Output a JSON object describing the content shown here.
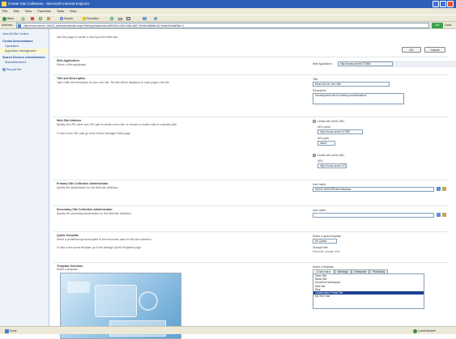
{
  "window": {
    "title": "Create Site Collection - Microsoft Internet Explorer"
  },
  "menu": [
    "File",
    "Edit",
    "View",
    "Favorites",
    "Tools",
    "Help"
  ],
  "toolbar": {
    "back": "Back",
    "search": "Search",
    "favorites": "Favorites",
    "go": "Go",
    "links": "Links"
  },
  "address": {
    "label": "Address",
    "url": "http://moss-server:16543/_admin/createsite.aspx?WebApplicationId=a39f00df-c1b9-4d8c-a5f7-49e5b2d8b6e1&CreateDefaultSite=1"
  },
  "sidebar": {
    "items": [
      {
        "label": "View All Site Content"
      },
      {
        "label": "Central Administration"
      },
      {
        "label": "Operations"
      },
      {
        "label": "Application Management"
      },
      {
        "label": "Shared Services Administration"
      },
      {
        "label": "SharedServices1"
      },
      {
        "label": "Recycle Bin"
      }
    ]
  },
  "page": {
    "intro": "Use this page to create a new top-level Web site.",
    "ok": "OK",
    "cancel": "Cancel"
  },
  "web_app": {
    "title": "Web Application",
    "desc": "Select a Web application.",
    "label": "Web Application:",
    "value": "http://moss-server:37358/"
  },
  "title_desc": {
    "title": "Title and Description",
    "desc": "Type a title and description for your new site. The title will be displayed on each page in the site.",
    "title_label": "Title:",
    "title_value": "Moss-Server Dev Site",
    "desc_label": "Description:",
    "desc_value": "Development site for testing customizations"
  },
  "web_site_address": {
    "title": "Web Site Address",
    "desc": "Specify the URL name and URL path to create a new site, or choose to create a site at a specific path.",
    "desc2": "To add a new URL path go to the Define Managed Paths page.",
    "opt1": "Create site at this URL:",
    "url_label": "URL name:",
    "url_value": "http://moss-server:37358",
    "path_label": "URL path:",
    "path_value": "/sites/",
    "opt2": "Create site at this URL:",
    "url2_label": "URL:",
    "url2_value": "http://moss-server:37358/"
  },
  "primary_admin": {
    "title": "Primary Site Collection Administrator",
    "desc": "Specify the administrator for this Web site collection.",
    "label": "User name:",
    "value": "MOSS-SERVER\\Administrator"
  },
  "secondary_admin": {
    "title": "Secondary Site Collection Administrator",
    "desc": "Specify the secondary administrator for this Web site collection.",
    "label": "User name:",
    "value": ""
  },
  "quota": {
    "title": "Quota Template",
    "desc": "Select a predefined quota template to limit resources used for this site collection.",
    "desc2": "To add a new quota template, go to the Manage Quota Templates page.",
    "label": "Select a quota template:",
    "value": "No Quota",
    "storage_label": "Storage limit:",
    "storage_value": "Maximum storage limit:"
  },
  "template": {
    "title": "Template Selection",
    "desc": "Select a template:",
    "label": "Select a template:",
    "tabs": [
      "Collaboration",
      "Meetings",
      "Enterprise",
      "Publishing"
    ],
    "items": [
      "Team Site",
      "Blank Site",
      "Document Workspace",
      "Wiki Site",
      "Blog",
      "Collaboration Portal Site",
      "My Site Host"
    ],
    "selected_index": 5
  },
  "status": {
    "left": "Done",
    "right": "Local intranet"
  }
}
